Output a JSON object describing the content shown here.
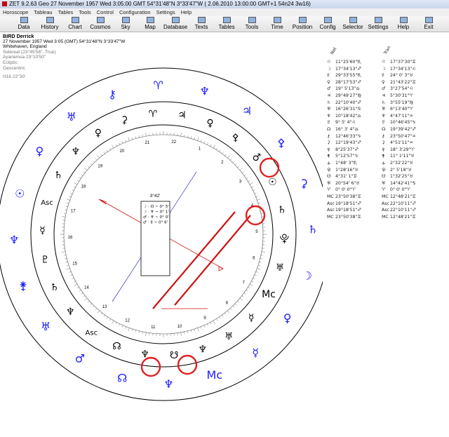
{
  "titlebar": {
    "text": "ZET 9.2.63 Geo    27 November 1957   Wed    3:05:00 GMT 54°31'48\"N  3°33'47\"W   ( 2.06.2010   13:00:00 GMT+1 54n24 3w16)"
  },
  "menu": [
    "Horoscope",
    "Tableau",
    "Tables",
    "Tools",
    "Control",
    "Configuration",
    "Settings",
    "Help"
  ],
  "toolbar": [
    "Data",
    "History",
    "Chart",
    "Cosmos",
    "Sky",
    "Map",
    "Database",
    "Texts",
    "Tables",
    "Tools",
    "Time",
    "Position",
    "Config",
    "Selector",
    "Settings",
    "Help",
    "Exit"
  ],
  "info": {
    "name": "BIRD Derrick",
    "line2": "27 November 1957  Wed   3:05 (GMT) 54°31'48\"N  3°33'47\"W",
    "line3": "Whitehaven, England",
    "sidereal": "Sidereal (23°45'56\", True)",
    "ayanamsa": "Ayanamsa 23°10'50\"",
    "ecliptic": "Ecliptic",
    "geocentric": "Geocentric",
    "houses": "H16  22°30'"
  },
  "table": {
    "col_nat": "Nat",
    "col_tran": "Tran",
    "rows": [
      {
        "p1": "☉",
        "v1": "11°25'60\"♏",
        "p2": "☉",
        "v2": "17°37'30\"♊"
      },
      {
        "p1": "☽",
        "v1": "17°34'13\"♐",
        "p2": "☽",
        "v2": "17°34'13\"♌"
      },
      {
        "p1": "☿",
        "v1": "29°33'55\"♏",
        "p2": "☿",
        "v2": "24° 0' 3\"♉"
      },
      {
        "p1": "♀",
        "v1": "28°17'53\"♐",
        "p2": "♀",
        "v2": "21°43'22\"♊"
      },
      {
        "p1": "♂",
        "v1": "19° 5'13\"♎",
        "p2": "♂",
        "v2": "3°27'54\"♌"
      },
      {
        "p1": "♃",
        "v1": "29°49'27\"♍",
        "p2": "♃",
        "v2": "5°30'31\"♈"
      },
      {
        "p1": "♄",
        "v1": "22°10'40\"♐",
        "p2": "♄",
        "v2": "3°55'19\"♍"
      },
      {
        "p1": "♅",
        "v1": "16°26'31\"♋",
        "p2": "♅",
        "v2": "6°13'40\"♈"
      },
      {
        "p1": "♆",
        "v1": "10°18'42\"♎",
        "p2": "♆",
        "v2": "4°47'11\"♒"
      },
      {
        "p1": "♇",
        "v1": "9° 5' 4\"♌",
        "p2": "♇",
        "v2": "10°46'45\"♑"
      },
      {
        "p1": "☊",
        "v1": "16° 3' 4\"♎",
        "p2": "☊",
        "v2": "19°39'42\"♐"
      },
      {
        "p1": "⚷",
        "v1": "12°46'33\"♑",
        "p2": "⚷",
        "v2": "23°50'47\"♒"
      },
      {
        "p1": "⚳",
        "v1": "12°19'43\"♐",
        "p2": "⚳",
        "v2": "4°51'11\"♒"
      },
      {
        "p1": "⚴",
        "v1": "8°25'37\"♐",
        "p2": "⚴",
        "v2": "18° 3'29\"♈"
      },
      {
        "p1": "⚵",
        "v1": "5°12'57\"♑",
        "p2": "⚵",
        "v2": "11° 1'11\"♉"
      },
      {
        "p1": "⚶",
        "v1": "1°48' 3\"♏",
        "p2": "⚶",
        "v2": "2°32'22\"♉"
      },
      {
        "p1": "⯓",
        "v1": "1°28'16\"♉",
        "p2": "⯓",
        "v2": "2° 5'18\"♉"
      },
      {
        "p1": "☋",
        "v1": "4°31' 1\"♊",
        "p2": "☋",
        "v2": "1°32'25\"♉"
      },
      {
        "p1": "♅",
        "v1": "20°54' 6\"♉",
        "p2": "♅",
        "v2": "14°42'41\"♋"
      },
      {
        "p1": "♈",
        "v1": "0° 0' 0\"♈",
        "p2": "♈",
        "v2": "0° 0' 0\"♈"
      },
      {
        "p1": "MC",
        "v1": "23°50'38\"♊",
        "p2": "MC",
        "v2": "12°48'21\"♊"
      },
      {
        "p1": "Asc",
        "v1": "19°18'51\"♐",
        "p2": "Asc",
        "v2": "22°10'11\"♐"
      },
      {
        "p1": "Asc",
        "v1": "19°18'51\"♐",
        "p2": "Asc",
        "v2": "22°10'11\"♐"
      },
      {
        "p1": "MC",
        "v1": "23°50'38\"♊",
        "p2": "MC",
        "v2": "12°48'21\"♊"
      }
    ]
  },
  "centerbox": {
    "title": "3°42'",
    "lines": [
      "☽ · ☊ ~ 0° 5'",
      "☽ · ♆ ~ 0° 1'",
      "♂ · ♆ ~ 0° 0'",
      "♂ · ☿ ~ 0° 6'"
    ]
  },
  "house_numbers": [
    "21",
    "22",
    "1",
    "2",
    "3",
    "4",
    "5",
    "6",
    "7",
    "8",
    "9",
    "10",
    "11",
    "12",
    "13",
    "14",
    "15",
    "16",
    "17",
    "18",
    "19",
    "20"
  ],
  "outer_glyphs": [
    {
      "g": "♈",
      "color": "#1a1aff"
    },
    {
      "g": "♆",
      "color": "#1a1aff"
    },
    {
      "g": "♃",
      "color": "#1a1aff"
    },
    {
      "g": "⚴",
      "color": "#1a1aff"
    },
    {
      "g": "⚳",
      "color": "#1a1aff"
    },
    {
      "g": "♄",
      "color": "#1a1aff"
    },
    {
      "g": "☽",
      "color": "#1a1aff"
    },
    {
      "g": "♀",
      "color": "#1a1aff"
    },
    {
      "g": "☿",
      "color": "#1a1aff"
    },
    {
      "g": "Mc",
      "color": "#1a1aff"
    },
    {
      "g": "♆",
      "color": "#1a1aff"
    },
    {
      "g": "☊",
      "color": "#1a1aff"
    },
    {
      "g": "♂",
      "color": "#1a1aff"
    },
    {
      "g": "♅",
      "color": "#1a1aff"
    },
    {
      "g": "⚵",
      "color": "#1a1aff"
    },
    {
      "g": "♆",
      "color": "#1a1aff"
    },
    {
      "g": "☉",
      "color": "#1a1aff"
    },
    {
      "g": "♀",
      "color": "#1a1aff"
    },
    {
      "g": "♅",
      "color": "#1a1aff"
    },
    {
      "g": "⚷",
      "color": "#1a1aff"
    }
  ],
  "inner_glyphs": [
    "♈",
    "♃",
    "♀",
    "⚴",
    "♂",
    "☉",
    "♄",
    "⯓",
    "♅",
    "Mc",
    "☿",
    "♅",
    "♆",
    "☋",
    "♆",
    "☊",
    "Asc",
    "♆",
    "♄",
    "♇",
    "☿",
    "Asc",
    "♄",
    "♆",
    "♀",
    "⚳"
  ],
  "colors": {
    "accent": "#1a1aff",
    "highlight": "#e02020",
    "aspect_red": "#cc1111",
    "aspect_blue": "#3333cc"
  }
}
